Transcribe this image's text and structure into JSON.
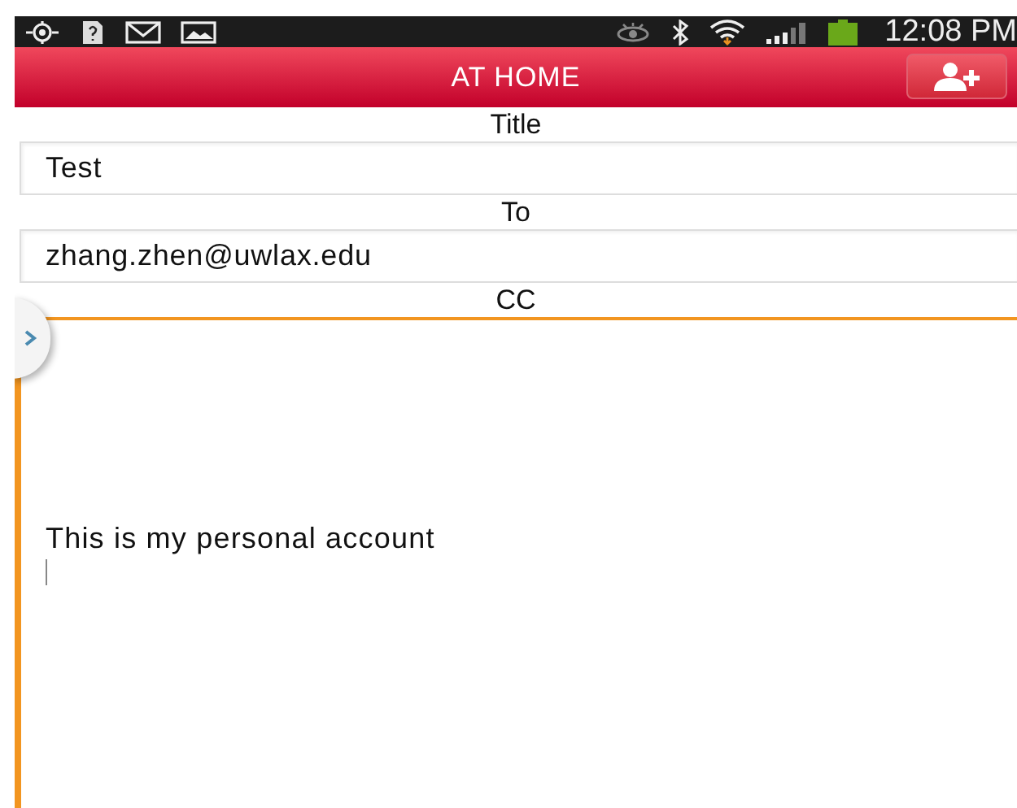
{
  "status_bar": {
    "time": "12:08 PM"
  },
  "header": {
    "title": "AT HOME"
  },
  "fields": [
    {
      "label": "Title",
      "value": "Test"
    },
    {
      "label": "To",
      "value": "zhang.zhen@uwlax.edu"
    }
  ],
  "body": {
    "label": "CC",
    "value": "This is my personal account",
    "focused": true
  }
}
